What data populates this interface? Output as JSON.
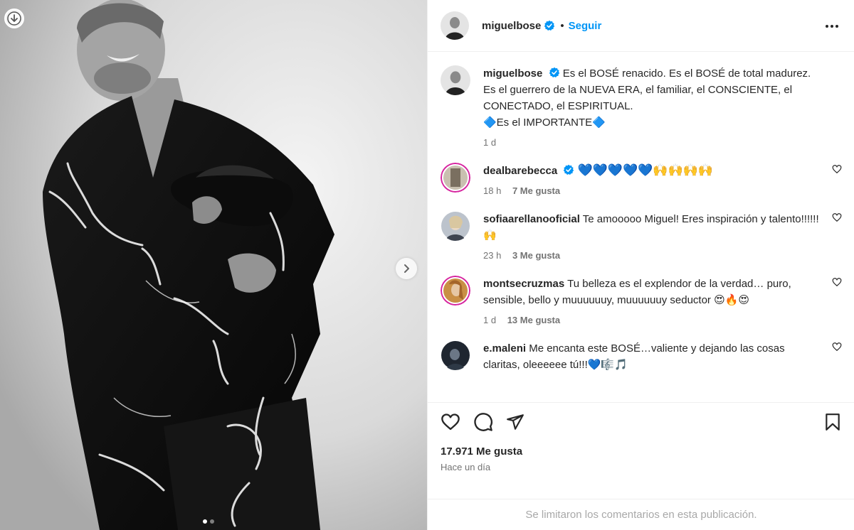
{
  "post": {
    "username": "miguelbose",
    "follow_label": "Seguir",
    "separator": "•",
    "caption": {
      "line1": "Es el BOSÉ renacido. Es el BOSÉ de total madurez.",
      "line2": "Es el guerrero de la NUEVA ERA, el familiar, el CONSCIENTE, el CONECTADO, el ESPIRITUAL.",
      "line3": "🔷Es el IMPORTANTE🔷",
      "time": "1 d"
    },
    "likes_total": "17.971 Me gusta",
    "posted_ago": "Hace un día",
    "comments_limited": "Se limitaron los comentarios en esta publicación."
  },
  "comments": [
    {
      "username": "dealbarebecca",
      "verified": true,
      "text": "💙💙💙💙💙🙌🙌🙌🙌",
      "time": "18 h",
      "likes": "7 Me gusta"
    },
    {
      "username": "sofiaarellanooficial",
      "verified": false,
      "text": "Te amooooo Miguel! Eres inspiración y talento!!!!!!🙌",
      "time": "23 h",
      "likes": "3 Me gusta"
    },
    {
      "username": "montsecruzmas",
      "verified": false,
      "text": "Tu belleza es el explendor de la verdad… puro, sensible, bello y muuuuuuy, muuuuuuy seductor 😍🔥😍",
      "time": "1 d",
      "likes": "13 Me gusta"
    },
    {
      "username": "e.maleni",
      "verified": false,
      "text": "Me encanta este BOSÉ…valiente y dejando las cosas claritas, oleeeeee tú!!!💙🎼🎵",
      "time": "",
      "likes": ""
    }
  ],
  "carousel": {
    "current": 1,
    "total": 2
  },
  "colors": {
    "accent": "#0095f6",
    "verified": "#0095f6",
    "muted": "#737373",
    "border": "#efefef"
  },
  "icons": {
    "download": "arrow-down-circle-icon",
    "next": "chevron-right-icon",
    "more": "more-horizontal-icon",
    "like": "heart-icon",
    "comment": "comment-bubble-icon",
    "share": "paper-plane-icon",
    "save": "bookmark-icon",
    "verified": "verified-badge-icon"
  }
}
